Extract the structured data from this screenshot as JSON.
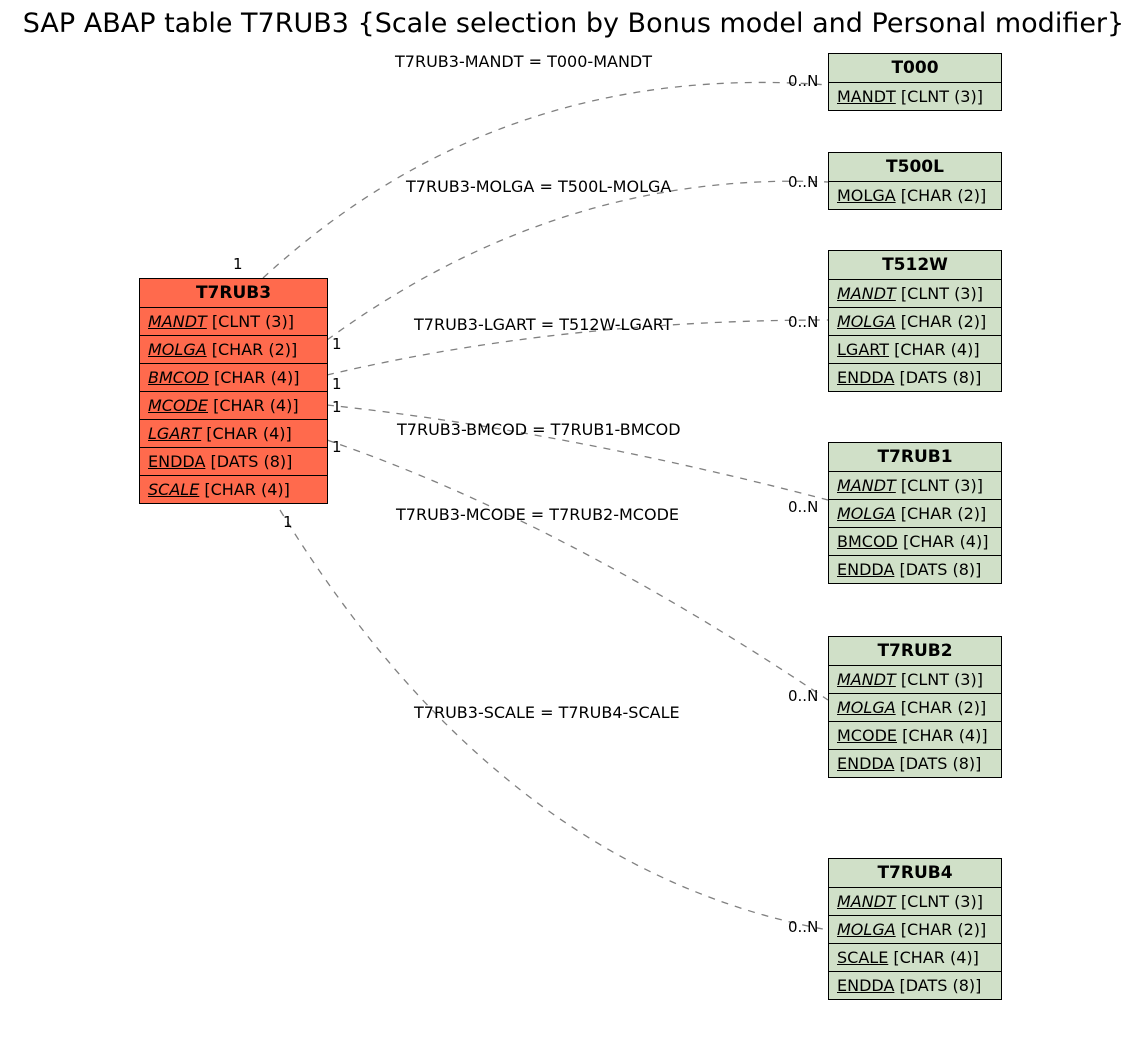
{
  "title": "SAP ABAP table T7RUB3 {Scale selection by Bonus model and Personal modifier}",
  "main": {
    "name": "T7RUB3",
    "fields": [
      {
        "name": "MANDT",
        "type": "[CLNT (3)]",
        "key": true
      },
      {
        "name": "MOLGA",
        "type": "[CHAR (2)]",
        "key": true
      },
      {
        "name": "BMCOD",
        "type": "[CHAR (4)]",
        "key": true
      },
      {
        "name": "MCODE",
        "type": "[CHAR (4)]",
        "key": true
      },
      {
        "name": "LGART",
        "type": "[CHAR (4)]",
        "key": true
      },
      {
        "name": "ENDDA",
        "type": "[DATS (8)]",
        "key": false
      },
      {
        "name": "SCALE",
        "type": "[CHAR (4)]",
        "key": true
      }
    ]
  },
  "refs": [
    {
      "name": "T000",
      "fields": [
        {
          "name": "MANDT",
          "type": "[CLNT (3)]",
          "key": false
        }
      ]
    },
    {
      "name": "T500L",
      "fields": [
        {
          "name": "MOLGA",
          "type": "[CHAR (2)]",
          "key": false
        }
      ]
    },
    {
      "name": "T512W",
      "fields": [
        {
          "name": "MANDT",
          "type": "[CLNT (3)]",
          "key": true
        },
        {
          "name": "MOLGA",
          "type": "[CHAR (2)]",
          "key": true
        },
        {
          "name": "LGART",
          "type": "[CHAR (4)]",
          "key": false
        },
        {
          "name": "ENDDA",
          "type": "[DATS (8)]",
          "key": false
        }
      ]
    },
    {
      "name": "T7RUB1",
      "fields": [
        {
          "name": "MANDT",
          "type": "[CLNT (3)]",
          "key": true
        },
        {
          "name": "MOLGA",
          "type": "[CHAR (2)]",
          "key": true
        },
        {
          "name": "BMCOD",
          "type": "[CHAR (4)]",
          "key": false
        },
        {
          "name": "ENDDA",
          "type": "[DATS (8)]",
          "key": false
        }
      ]
    },
    {
      "name": "T7RUB2",
      "fields": [
        {
          "name": "MANDT",
          "type": "[CLNT (3)]",
          "key": true
        },
        {
          "name": "MOLGA",
          "type": "[CHAR (2)]",
          "key": true
        },
        {
          "name": "MCODE",
          "type": "[CHAR (4)]",
          "key": false
        },
        {
          "name": "ENDDA",
          "type": "[DATS (8)]",
          "key": false
        }
      ]
    },
    {
      "name": "T7RUB4",
      "fields": [
        {
          "name": "MANDT",
          "type": "[CLNT (3)]",
          "key": true
        },
        {
          "name": "MOLGA",
          "type": "[CHAR (2)]",
          "key": true
        },
        {
          "name": "SCALE",
          "type": "[CHAR (4)]",
          "key": false
        },
        {
          "name": "ENDDA",
          "type": "[DATS (8)]",
          "key": false
        }
      ]
    }
  ],
  "edges": [
    {
      "label": "T7RUB3-MANDT = T000-MANDT",
      "left": "1",
      "right": "0..N"
    },
    {
      "label": "T7RUB3-MOLGA = T500L-MOLGA",
      "left": "1",
      "right": "0..N"
    },
    {
      "label": "T7RUB3-LGART = T512W-LGART",
      "left": "1",
      "right": "0..N"
    },
    {
      "label": "T7RUB3-BMCOD = T7RUB1-BMCOD",
      "left": "1",
      "right": ""
    },
    {
      "label": "T7RUB3-MCODE = T7RUB2-MCODE",
      "left": "1",
      "right": "0..N"
    },
    {
      "label": "T7RUB3-SCALE = T7RUB4-SCALE",
      "left": "1",
      "right": "0..N"
    }
  ]
}
